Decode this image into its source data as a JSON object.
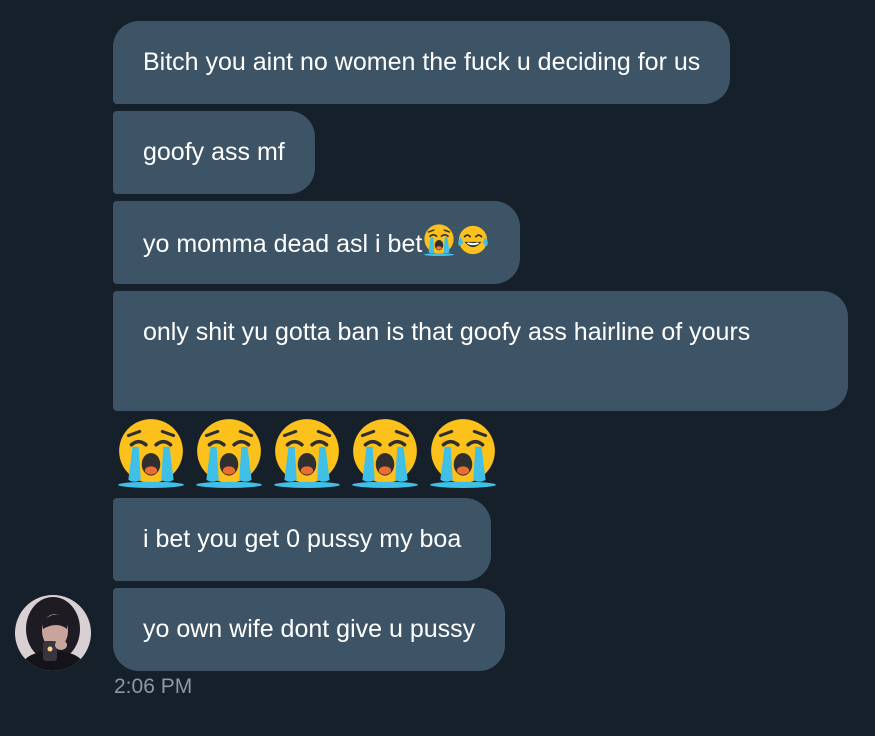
{
  "conversation": {
    "messages": [
      {
        "text": "Bitch you aint no women the fuck u deciding for us"
      },
      {
        "text": "goofy ass mf"
      },
      {
        "text": "yo momma dead asl i bet",
        "emojis": [
          "loudly-crying-face-icon",
          "face-with-tears-of-joy-icon"
        ]
      },
      {
        "text": "only shit yu gotta ban is that goofy ass hairline of yours"
      },
      {
        "text": "",
        "emojis": [
          "loudly-crying-face-icon",
          "loudly-crying-face-icon",
          "loudly-crying-face-icon",
          "loudly-crying-face-icon",
          "loudly-crying-face-icon"
        ]
      },
      {
        "text": "i bet you get 0 pussy my boa"
      },
      {
        "text": "yo own wife dont give u pussy"
      }
    ],
    "timestamp": "2:06 PM"
  },
  "colors": {
    "background": "#16202a",
    "bubble": "#3d5466",
    "text": "#ffffff",
    "timestamp": "#8b98a5"
  }
}
